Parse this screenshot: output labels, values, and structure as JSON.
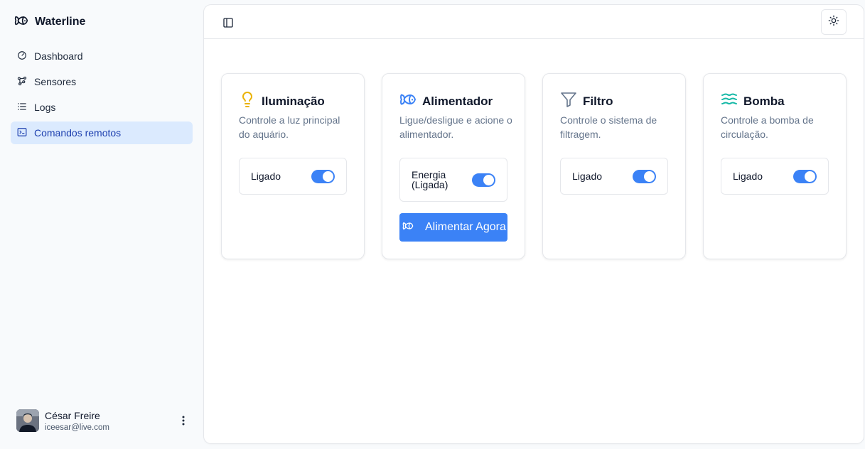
{
  "app": {
    "name": "Waterline",
    "logo_icon": "fish-icon"
  },
  "sidebar": {
    "items": [
      {
        "label": "Dashboard",
        "icon": "gauge-icon",
        "active": false
      },
      {
        "label": "Sensores",
        "icon": "nodes-icon",
        "active": false
      },
      {
        "label": "Logs",
        "icon": "list-icon",
        "active": false
      },
      {
        "label": "Comandos remotos",
        "icon": "terminal-icon",
        "active": true
      }
    ],
    "user": {
      "name": "César Freire",
      "email": "iceesar@live.com"
    }
  },
  "topbar": {
    "toggle_icon": "sidebar-toggle-icon",
    "theme_icon": "sun-icon"
  },
  "cards": [
    {
      "id": "iluminacao",
      "title": "Iluminação",
      "icon": "lightbulb-icon",
      "icon_color": "#eab308",
      "description": "Controle a luz principal do aquário.",
      "toggle": {
        "label": "Ligado",
        "on": true
      }
    },
    {
      "id": "alimentador",
      "title": "Alimentador",
      "icon": "fish-icon",
      "icon_color": "#3b82f6",
      "description": "Ligue/desligue e acione o alimentador.",
      "toggle": {
        "label": "Energia (Ligada)",
        "on": true
      },
      "action": {
        "label": "Alimentar Agora",
        "icon": "fish-icon"
      }
    },
    {
      "id": "filtro",
      "title": "Filtro",
      "icon": "funnel-icon",
      "icon_color": "#64748b",
      "description": "Controle o sistema de filtragem.",
      "toggle": {
        "label": "Ligado",
        "on": true
      }
    },
    {
      "id": "bomba",
      "title": "Bomba",
      "icon": "waves-icon",
      "icon_color": "#14b8a6",
      "description": "Controle a bomba de circulação.",
      "toggle": {
        "label": "Ligado",
        "on": true
      }
    }
  ],
  "colors": {
    "accent": "#3b82f6",
    "active_nav_bg": "#dbeafe",
    "active_nav_text": "#1e40af"
  }
}
